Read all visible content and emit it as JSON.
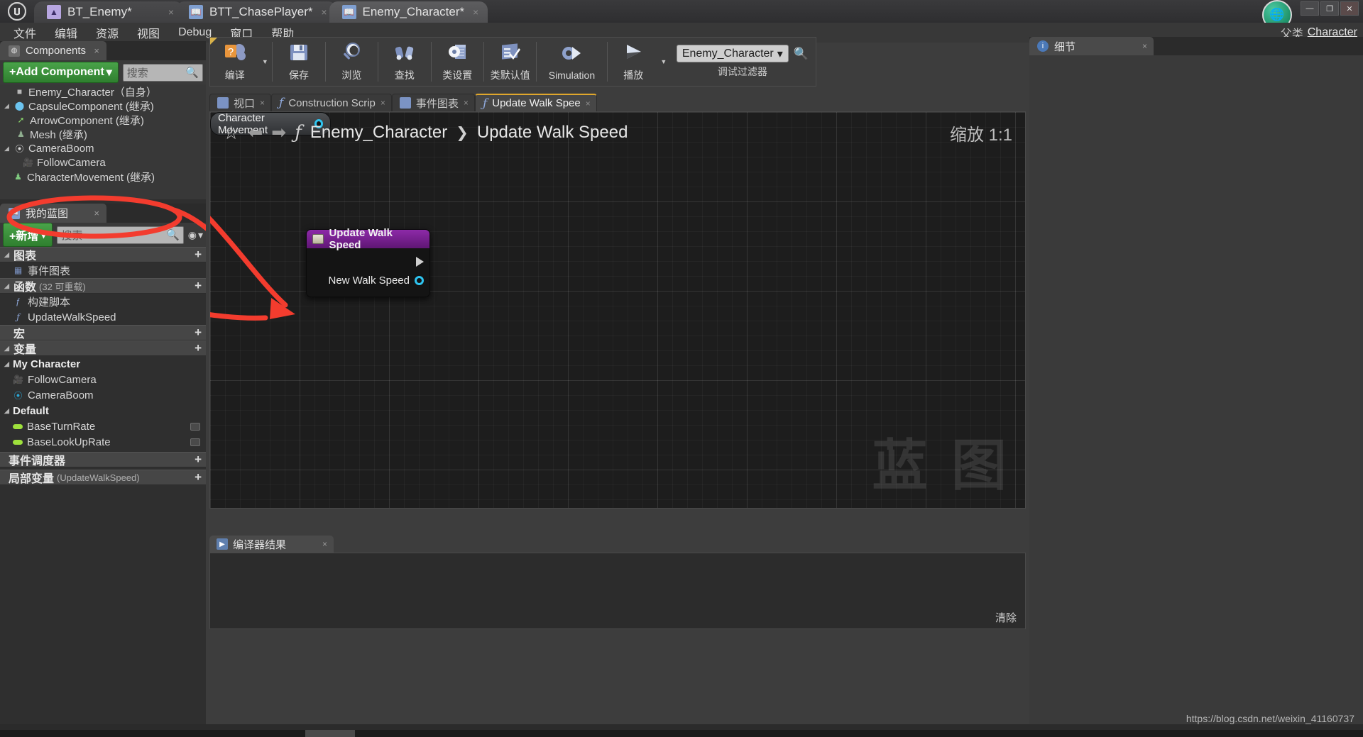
{
  "window": {
    "tabs": [
      {
        "label": "BT_Enemy*",
        "icon": "behavior-tree-icon",
        "active": false
      },
      {
        "label": "BTT_ChasePlayer*",
        "icon": "blueprint-book-icon",
        "active": false
      },
      {
        "label": "Enemy_Character*",
        "icon": "blueprint-book-icon",
        "active": true
      }
    ],
    "close_glyph": "×",
    "minimize": "—",
    "maximize": "❐",
    "close": "✕",
    "logo": "♈"
  },
  "menu": {
    "items": [
      "文件",
      "编辑",
      "资源",
      "视图",
      "Debug",
      "窗口",
      "帮助"
    ],
    "parent_class_label": "父类",
    "parent_class_value": "Character"
  },
  "components_panel": {
    "tab_label": "Components",
    "tab_close": "×",
    "add_component_label": "+Add Component",
    "add_component_caret": "▾",
    "search_placeholder": "搜索",
    "search_icon": "magnifier-icon",
    "tree": [
      {
        "label": "Enemy_Character（自身）",
        "indent": 0,
        "twisty": "",
        "icon": "capsule-root-icon",
        "color": "#b9b9b9"
      },
      {
        "label": "CapsuleComponent (继承)",
        "indent": 0,
        "twisty": "◢",
        "icon": "capsule-icon",
        "color": "#6cc4ef"
      },
      {
        "label": "ArrowComponent (继承)",
        "indent": 1,
        "twisty": "",
        "icon": "arrow-icon",
        "color": "#8ad46b"
      },
      {
        "label": "Mesh (继承)",
        "indent": 1,
        "twisty": "",
        "icon": "mesh-icon",
        "color": "#8fae8f"
      },
      {
        "label": "CameraBoom",
        "indent": 0,
        "twisty": "◢",
        "icon": "spring-arm-icon",
        "color": "#cfcfcf"
      },
      {
        "label": "FollowCamera",
        "indent": 1,
        "twisty": "",
        "icon": "camera-icon",
        "color": "#6fb9d8"
      },
      {
        "label": "CharacterMovement (继承)",
        "indent": 0,
        "twisty": "",
        "icon": "character-movement-icon",
        "color": "#7fc97f"
      }
    ]
  },
  "my_blueprint_panel": {
    "tab_label": "我的蓝图",
    "tab_close": "×",
    "add_label": "+新增",
    "add_caret": "▾",
    "search_placeholder": "搜索",
    "eye_glyph": "◉",
    "eye_caret": "▾",
    "sections": [
      {
        "name": "图表",
        "suffix": "",
        "twisty": "◢",
        "plus": "+",
        "items": [
          {
            "label": "事件图表",
            "icon": "event-graph-icon",
            "color": "#7b93c4"
          }
        ]
      },
      {
        "name": "函数",
        "suffix": "(32 可重载)",
        "twisty": "◢",
        "plus": "+",
        "items": [
          {
            "label": "构建脚本",
            "icon": "construction-script-icon",
            "color": "#8fa8da"
          },
          {
            "label": "UpdateWalkSpeed",
            "icon": "function-icon",
            "color": "#8fa8da"
          }
        ]
      },
      {
        "name": "宏",
        "suffix": "",
        "twisty": "",
        "plus": "+",
        "items": []
      },
      {
        "name": "变量",
        "suffix": "",
        "twisty": "◢",
        "plus": "+",
        "items": []
      }
    ],
    "variable_categories": [
      {
        "name": "My Character",
        "twisty": "◢",
        "variables": [
          {
            "label": "FollowCamera",
            "icon": "camera-icon",
            "color": "#2aa8d8",
            "kind": "object"
          },
          {
            "label": "CameraBoom",
            "icon": "spring-arm-icon",
            "color": "#2aa8d8",
            "kind": "object"
          }
        ]
      },
      {
        "name": "Default",
        "twisty": "◢",
        "variables": [
          {
            "label": "BaseTurnRate",
            "icon": "float-pin-icon",
            "color": "#9ee03c",
            "kind": "float"
          },
          {
            "label": "BaseLookUpRate",
            "icon": "float-pin-icon",
            "color": "#9ee03c",
            "kind": "float"
          }
        ]
      }
    ],
    "footer_sections": [
      {
        "name": "事件调度器",
        "suffix": "",
        "plus": "+"
      },
      {
        "name": "局部变量",
        "suffix": "(UpdateWalkSpeed)",
        "plus": "+"
      }
    ]
  },
  "blueprint_toolbar": {
    "buttons": [
      {
        "label": "编译",
        "icon": "compile-question-icon",
        "glyph": "⚙",
        "caret": true,
        "wide": false
      },
      {
        "label": "保存",
        "icon": "save-floppy-icon",
        "glyph": "💾",
        "caret": false,
        "wide": false
      },
      {
        "label": "浏览",
        "icon": "browse-magnifier-icon",
        "glyph": "🔍",
        "caret": false,
        "wide": false
      },
      {
        "label": "查找",
        "icon": "find-binoculars-icon",
        "glyph": "⚲",
        "caret": false,
        "wide": false
      },
      {
        "label": "类设置",
        "icon": "class-settings-icon",
        "glyph": "⚙",
        "caret": false,
        "wide": false
      },
      {
        "label": "类默认值",
        "icon": "class-defaults-icon",
        "glyph": "☑",
        "caret": false,
        "wide": false
      },
      {
        "label": "Simulation",
        "icon": "simulation-icon",
        "glyph": "⚙",
        "caret": false,
        "wide": true
      },
      {
        "label": "播放",
        "icon": "play-icon",
        "glyph": "▶",
        "caret": true,
        "wide": false
      }
    ],
    "debug_filter_label": "调试过滤器",
    "debug_filter_value": "Enemy_Character",
    "debug_filter_caret": "▾",
    "debug_search_icon": "magnifier-icon"
  },
  "graph_tabs": [
    {
      "label": "视口",
      "icon": "viewport-icon",
      "active": false,
      "close": "×"
    },
    {
      "label": "Construction Scrip",
      "icon": "function-icon",
      "active": false,
      "close": "×"
    },
    {
      "label": "事件图表",
      "icon": "event-graph-icon",
      "active": false,
      "close": "×"
    },
    {
      "label": "Update Walk Spee",
      "icon": "function-icon",
      "active": true,
      "close": "×"
    }
  ],
  "graph": {
    "star_icon": "favorite-star-icon",
    "back_icon": "back-arrow-icon",
    "forward_icon": "forward-arrow-icon",
    "fx_icon": "function-icon",
    "breadcrumb_root": "Enemy_Character",
    "breadcrumb_sep": "❯",
    "breadcrumb_current": "Update Walk Speed",
    "zoom_label": "缩放 1:1",
    "watermark": "蓝 图",
    "nodes": [
      {
        "id": "update-walk-speed-entry",
        "title": "Update Walk Speed",
        "type": "function-entry",
        "header_color": "#8d2aa8",
        "pins": [
          {
            "label": "",
            "kind": "exec-out"
          },
          {
            "label": "New Walk Speed",
            "kind": "object-out"
          }
        ]
      },
      {
        "id": "character-movement-var",
        "title": "Character Movement",
        "type": "variable-get",
        "pins": [
          {
            "label": "",
            "kind": "object-out"
          }
        ]
      }
    ]
  },
  "compiler_results": {
    "tab_label": "编译器结果",
    "tab_icon": "compiler-results-icon",
    "tab_close": "×",
    "clear_label": "清除",
    "messages": []
  },
  "details_panel": {
    "tab_label": "细节",
    "tab_icon": "info-icon",
    "tab_close": "×"
  },
  "footer": {
    "watermark_url": "https://blog.csdn.net/weixin_41160737"
  },
  "colors": {
    "accent_green": "#2f7f2f",
    "node_purple": "#8d2aa8",
    "pin_blue": "#2ec4f0",
    "annotation_red": "#f33c2e",
    "tab_highlight": "#e0a72c"
  }
}
